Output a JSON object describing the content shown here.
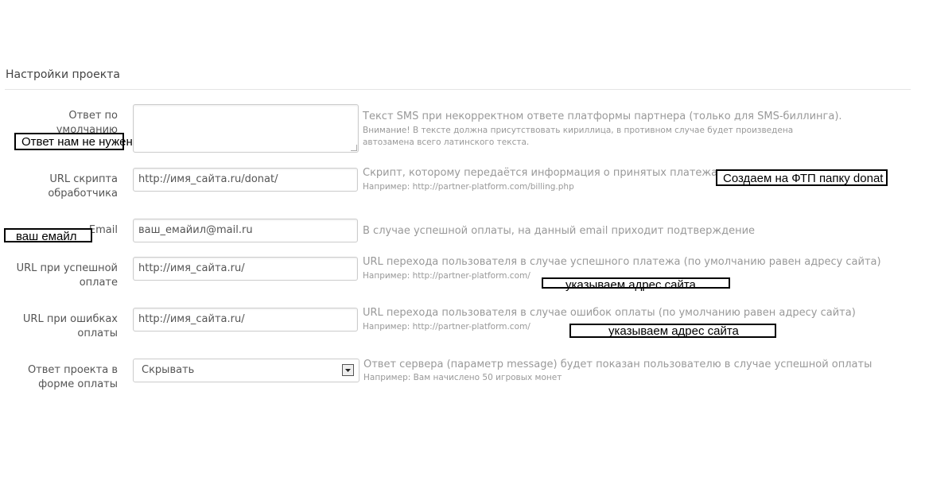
{
  "section": {
    "title": "Настройки проекта"
  },
  "fields": {
    "default_answer": {
      "label": "Ответ по умолчанию",
      "value": "",
      "help": "Текст SMS при некорректном ответе платформы партнера (только для SMS-биллинга).",
      "help_small_1": "Внимание! В тексте должна присутствовать кириллица, в противном случае будет произведена",
      "help_small_2": "автозамена всего латинского текста."
    },
    "handler_url": {
      "label_1": "URL скрипта",
      "label_2": "обработчика",
      "value": "http://имя_сайта.ru/donat/",
      "help": "Скрипт, которому передаётся информация о принятых платежах",
      "help_small": "Например: http://partner-platform.com/billing.php"
    },
    "email": {
      "label": "Email",
      "value": "ваш_емайил@mail.ru",
      "help": "В случае успешной оплаты, на данный email приходит подтверждение"
    },
    "success_url": {
      "label_1": "URL при успешной",
      "label_2": "оплате",
      "value": "http://имя_сайта.ru/",
      "help": "URL перехода пользователя в случае успешного платежа (по умолчанию равен адресу сайта)",
      "help_small": "Например: http://partner-platform.com/"
    },
    "error_url": {
      "label_1": "URL при ошибках",
      "label_2": "оплаты",
      "value": "http://имя_сайта.ru/",
      "help": "URL перехода пользователя в случае ошибок оплаты (по умолчанию равен адресу сайта)",
      "help_small": "Например: http://partner-platform.com/"
    },
    "payment_form_answer": {
      "label_1": "Ответ проекта в",
      "label_2": "форме оплаты",
      "selected": "Скрывать",
      "help": "Ответ сервера (параметр message) будет показан пользователю в случае успешной оплаты",
      "help_small": "Например: Вам начислено 50 игровых монет"
    }
  },
  "annotations": {
    "default_answer_note": "Ответ нам не нужен",
    "ftp_note": "Создаем на ФТП папку donat",
    "email_note": "ваш емайл",
    "success_note": "указываем адрес сайта",
    "error_note": "указываем адрес сайта"
  }
}
